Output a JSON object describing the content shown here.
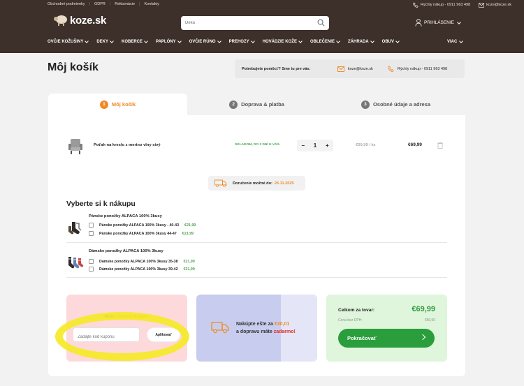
{
  "topbar": {
    "links": [
      "Obchodné podmienky",
      "GDPR",
      "Reklamácie",
      "Kontakty"
    ],
    "phone": "Rýchly nákup - 0911 963 498",
    "email": "koze@koze.sk"
  },
  "header": {
    "logo_text": "koze.sk",
    "search_placeholder": "Deka",
    "login_label": "PRIHLÁSENIE"
  },
  "nav": {
    "items": [
      "OVČIE KOŽUŠINY",
      "DEKY",
      "KOBERCE",
      "PAPLÓNY",
      "OVČIE RÚNO",
      "PREHOZY",
      "HOVÄDZIE KOŽE",
      "OBLEČENIE",
      "ZÁHRADA",
      "OBUV"
    ],
    "more": "VIAC"
  },
  "page": {
    "title": "Môj košík",
    "help_question": "Potrebujete pomôcť? Sme tu pre vás:",
    "help_email": "koze@koze.sk",
    "help_phone": "Rýchly nákup - 0911 963 498"
  },
  "steps": [
    {
      "num": "1",
      "label": "Môj košík"
    },
    {
      "num": "2",
      "label": "Doprava & platba"
    },
    {
      "num": "3",
      "label": "Osobné údaje a adresa"
    }
  ],
  "cart_item": {
    "name": "Poťah na kreslo z merino vlny sivý",
    "stock": "SKLADOM, DO 3 DNÍ U VÁS.",
    "minus": "−",
    "qty": "1",
    "plus": "+",
    "unit_price": "€69,99  / ks",
    "total": "€69,99"
  },
  "delivery": {
    "label": "Doručenie možné do:",
    "date": "26.11.2025"
  },
  "upsell": {
    "title": "Vyberte si k nákupu",
    "groups": [
      {
        "title": "Pánske ponožky ALPACA 100% 3kusy",
        "options": [
          {
            "label": "Pánske ponožky ALPACA 100% 3kusy - 40-43",
            "price": "€21,99"
          },
          {
            "label": "Pánske ponožky ALPACA 100% 3kusy 44-47",
            "price": "€21,99"
          }
        ]
      },
      {
        "title": "Dámske ponožky ALPACA 100% 3kusy",
        "options": [
          {
            "label": "Dámske ponožky ALPACA 100% 3kusy 35-38",
            "price": "€21,99"
          },
          {
            "label": "Dámske ponožky ALPACA 100% 3kusy 39-42",
            "price": "€21,99"
          }
        ]
      }
    ]
  },
  "coupon": {
    "label_prefix": "Mám",
    "label_highlight": "zľavový kupón:",
    "placeholder": "Zadajte kód kupónu",
    "apply": "Aplikovať"
  },
  "shipping": {
    "progress": 0.7,
    "line1_prefix": "Nakúpte ešte za",
    "amount": "€30,01",
    "line2_prefix": "a dopravu máte",
    "free": "zadarmo!"
  },
  "summary": {
    "total_label": "Celkom za tovar:",
    "total_value": "€69,99",
    "net_label": "Cena bez DPH:",
    "net_value": "€56,90",
    "continue": "Pokračovať"
  },
  "colors": {
    "header_bg": "#3d2f29",
    "accent_orange": "#f08a24",
    "green": "#2a9e3c",
    "coupon_bg": "#fdd9dc",
    "highlight_yellow": "#f5e928"
  }
}
